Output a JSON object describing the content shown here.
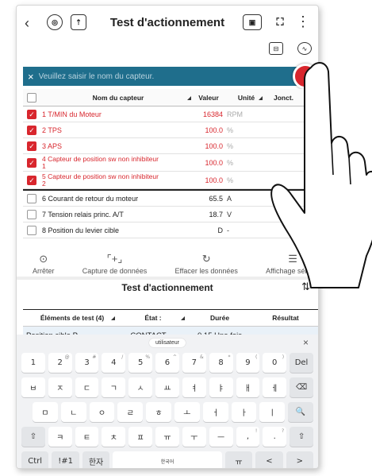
{
  "header": {
    "back_icon": "‹",
    "title": "Test d'actionnement",
    "more_icon": "⋮"
  },
  "search": {
    "close_icon": "×",
    "placeholder": "Veuillez saisir le nom du capteur."
  },
  "sensor_table": {
    "columns": [
      "Nom du capteur",
      "Valeur",
      "Unité",
      "Jonct."
    ],
    "rows": [
      {
        "name": "1 T/MIN du Moteur",
        "value": "16384",
        "unit": "RPM",
        "checked": true
      },
      {
        "name": "2 TPS",
        "value": "100.0",
        "unit": "%",
        "checked": true
      },
      {
        "name": "3 APS",
        "value": "100.0",
        "unit": "%",
        "checked": true
      },
      {
        "name": "4 Capteur de position sw non inhibiteur 1",
        "name_line1": "4 Capteur de position sw non inhibiteur",
        "name_line2": "1",
        "value": "100.0",
        "unit": "%",
        "checked": true
      },
      {
        "name": "5 Capteur de position sw non inhibiteur 2",
        "name_line1": "5 Capteur de position sw non inhibiteur",
        "name_line2": "2",
        "value": "100.0",
        "unit": "%",
        "checked": true
      },
      {
        "name": "6 Courant de retour du moteur",
        "value": "65.5",
        "unit": "A",
        "checked": false
      },
      {
        "name": "7 Tension relais princ. A/T",
        "value": "18.7",
        "unit": "V",
        "checked": false
      },
      {
        "name": "8 Position du levier cible",
        "value": "D",
        "unit": "-",
        "checked": false
      }
    ]
  },
  "toolbar": {
    "stop": "Arrêter",
    "capture": "Capture de données",
    "erase": "Effacer les données",
    "display": "Affichage sélectif"
  },
  "test": {
    "title": "Test d'actionnement",
    "columns": [
      "Éléments de test (4)",
      "État :",
      "Durée",
      "Résultat"
    ],
    "row": {
      "item": "Position cible P",
      "state": "CONTACT",
      "duration": "0.15 Une fois",
      "result": ""
    }
  },
  "keyboard": {
    "suggestion": "utilisateur",
    "close": "×",
    "row1": [
      [
        "1",
        ""
      ],
      [
        "2",
        "@"
      ],
      [
        "3",
        "#"
      ],
      [
        "4",
        "/"
      ],
      [
        "5",
        "%"
      ],
      [
        "6",
        "^"
      ],
      [
        "7",
        "&"
      ],
      [
        "8",
        "*"
      ],
      [
        "9",
        "("
      ],
      [
        "0",
        ")"
      ],
      [
        "Del",
        ""
      ]
    ],
    "row2": [
      "ㅂ",
      "ㅈ",
      "ㄷ",
      "ㄱ",
      "ㅅ",
      "ㅛ",
      "ㅕ",
      "ㅑ",
      "ㅐ",
      "ㅔ",
      "⌫"
    ],
    "row3": [
      "ㅁ",
      "ㄴ",
      "ㅇ",
      "ㄹ",
      "ㅎ",
      "ㅗ",
      "ㅓ",
      "ㅏ",
      "ㅣ",
      "🔍"
    ],
    "row4": [
      [
        "⇧",
        ""
      ],
      [
        "ㅋ",
        ""
      ],
      [
        "ㅌ",
        ""
      ],
      [
        "ㅊ",
        ""
      ],
      [
        "ㅍ",
        ""
      ],
      [
        "ㅠ",
        ""
      ],
      [
        "ㅜ",
        ""
      ],
      [
        "ㅡ",
        ""
      ],
      [
        ",",
        "!"
      ],
      [
        ".",
        "?"
      ],
      [
        "⇧",
        ""
      ]
    ],
    "row5": {
      "ctrl": "Ctrl",
      "sym": "!#1",
      "hanja": "한자",
      "space": "한국어",
      "lang": "ㅠ",
      "left": "<",
      "right": ">"
    }
  },
  "colors": {
    "accent": "#d8262d",
    "searchbar": "#1f6e8c"
  }
}
